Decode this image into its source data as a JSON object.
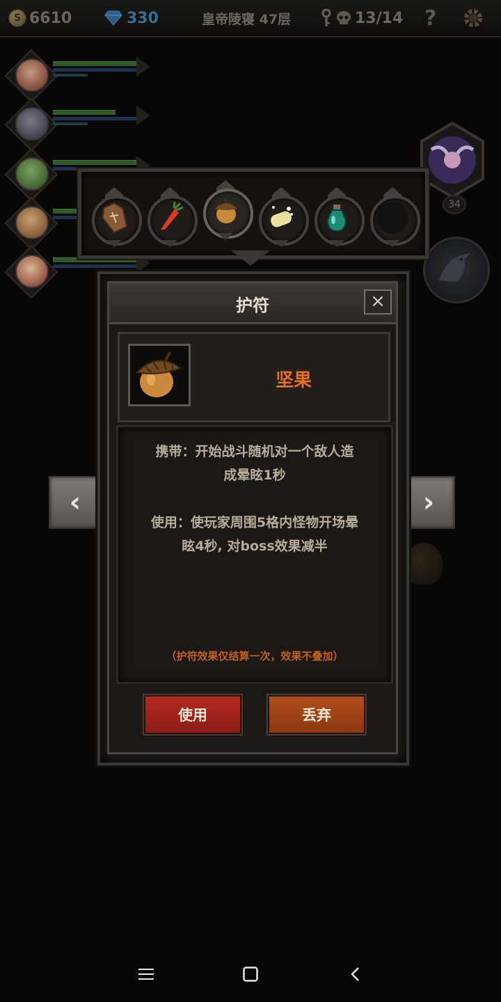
{
  "topbar": {
    "gold": "6610",
    "gems": "330",
    "floor": "皇帝陵寝 47层",
    "kills": "13/14",
    "help": "?",
    "coin_symbol": "S"
  },
  "boss": {
    "level": "34"
  },
  "items": [
    {
      "name": "coffin",
      "icon": "coffin-icon"
    },
    {
      "name": "carrot",
      "icon": "carrot-icon"
    },
    {
      "name": "acorn",
      "icon": "acorn-icon",
      "selected": true
    },
    {
      "name": "soap",
      "icon": "soap-icon"
    },
    {
      "name": "potion",
      "icon": "potion-icon"
    },
    {
      "name": "empty",
      "icon": "empty-slot"
    }
  ],
  "dialog": {
    "title": "护符",
    "close": "×",
    "item_name": "坚果",
    "desc_carry_l1": "携带：开始战斗随机对一个敌人造",
    "desc_carry_l2": "成晕眩1秒",
    "desc_use_l1": "使用：使玩家周围5格内怪物开场晕",
    "desc_use_l2": "眩4秒, 对boss效果减半",
    "note": "（护符效果仅结算一次，效果不叠加）",
    "use_label": "使用",
    "discard_label": "丢弃"
  },
  "nav": {
    "prev": "‹",
    "next": "›"
  },
  "colors": {
    "item_name": "#e8701f",
    "note": "#c2601d",
    "use_button": "#b42a20",
    "discard_button": "#b24e1d"
  }
}
